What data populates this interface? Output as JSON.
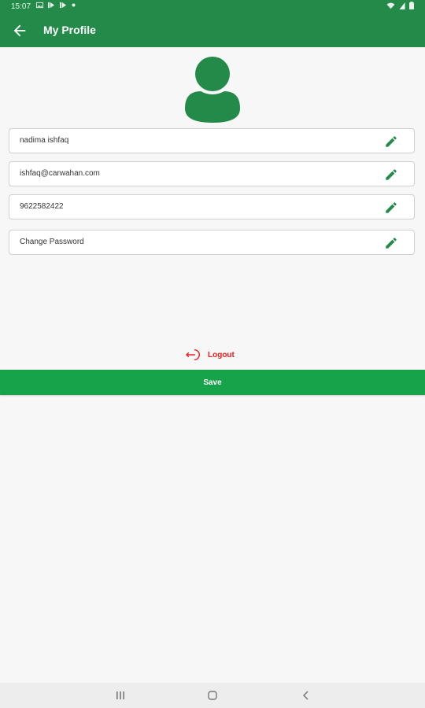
{
  "status_bar": {
    "time": "15:07",
    "left_icons": [
      "image-icon",
      "play-icon",
      "play-icon",
      "dot-icon"
    ],
    "right_icons": [
      "wifi-icon",
      "signal-icon",
      "battery-icon"
    ]
  },
  "app_bar": {
    "title": "My Profile",
    "back_icon": "arrow-left-icon",
    "background": "#238a4a"
  },
  "avatar": {
    "icon": "user-avatar-icon",
    "color": "#238a4a"
  },
  "fields": [
    {
      "name": "name",
      "value": "nadima ishfaq",
      "icon": "pencil-icon"
    },
    {
      "name": "email",
      "value": "ishfaq@carwahan.com",
      "icon": "pencil-icon"
    },
    {
      "name": "phone",
      "value": "9622582422",
      "icon": "pencil-icon"
    },
    {
      "name": "password",
      "value": "Change Password",
      "icon": "pencil-icon"
    }
  ],
  "logout": {
    "label": "Logout",
    "icon": "logout-icon",
    "color": "#e41e1e"
  },
  "save": {
    "label": "Save",
    "color": "#16a34a"
  },
  "nav_bar": {
    "buttons": [
      "recents-icon",
      "home-icon",
      "back-icon"
    ]
  }
}
